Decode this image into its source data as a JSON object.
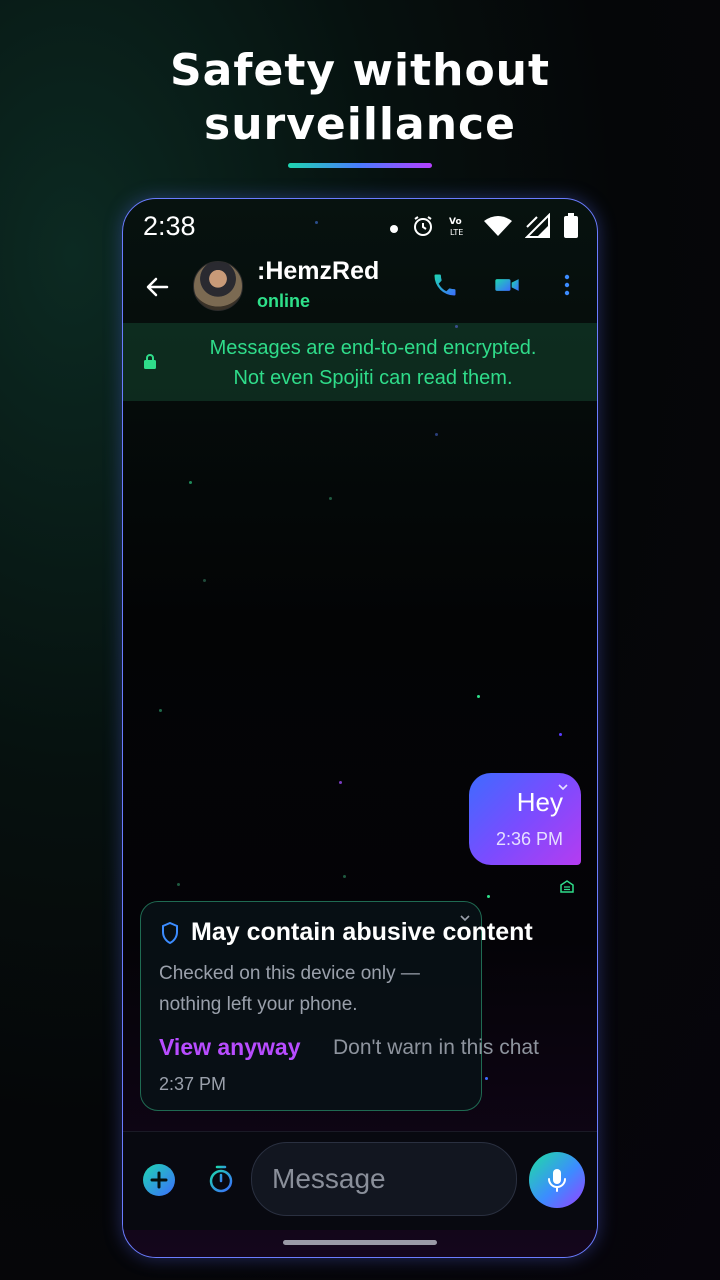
{
  "headline": {
    "line1": "Safety without",
    "line2": "surveillance"
  },
  "status_bar": {
    "time": "2:38",
    "icons": [
      "notification-dot-icon",
      "alarm-icon",
      "volte-icon",
      "wifi-icon",
      "signal-icon",
      "battery-icon"
    ]
  },
  "chat_header": {
    "contact_name": ":HemzRed",
    "status": "online",
    "actions": [
      "phone-icon",
      "video-icon",
      "more-icon"
    ]
  },
  "encryption_banner": {
    "line1": "Messages are end-to-end encrypted.",
    "line2": "Not even Spojiti can read them."
  },
  "messages": [
    {
      "direction": "outgoing",
      "text": "Hey",
      "time": "2:36 PM"
    }
  ],
  "warning_card": {
    "title": "May contain abusive content",
    "body_line1": "Checked on this device only —",
    "body_line2": "nothing left your phone.",
    "primary_action": "View anyway",
    "secondary_action": "Don't warn in this chat",
    "time": "2:37 PM"
  },
  "composer": {
    "placeholder": "Message"
  },
  "colors": {
    "accent_green": "#2ee08a",
    "accent_purple": "#b84cff",
    "accent_blue": "#3c6dff"
  }
}
